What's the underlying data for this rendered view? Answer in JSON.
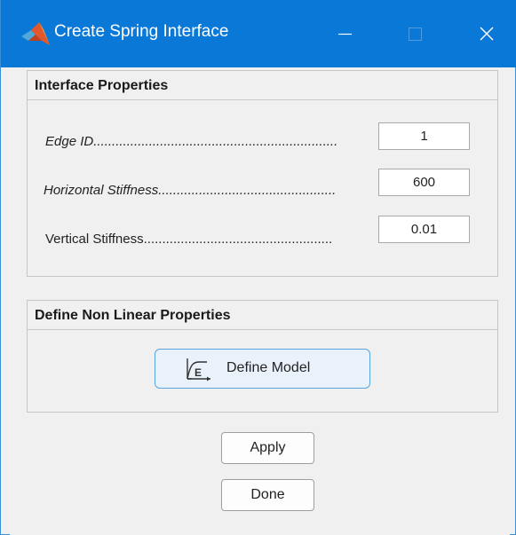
{
  "window": {
    "title": "Create Spring Interface",
    "app_icon": "matlab-logo-icon",
    "title_bar_color": "#0a78d7",
    "controls": [
      "minimize-icon",
      "maximize-icon",
      "close-icon"
    ]
  },
  "interface_properties": {
    "heading": "Interface Properties",
    "fields": [
      {
        "label": "Edge ID",
        "leader": "..................................................................",
        "value": "1"
      },
      {
        "label": "Horizontal Stiffness",
        "leader": "................................................",
        "value": "600"
      },
      {
        "label": "Vertical Stiffness",
        "leader": "...................................................",
        "value": "0.01"
      }
    ]
  },
  "nonlinear": {
    "heading": "Define Non Linear Properties",
    "define_button": {
      "icon": "stress-strain-curve-icon",
      "label": "Define Model"
    }
  },
  "actions": {
    "apply_label": "Apply",
    "done_label": "Done"
  },
  "colors": {
    "accent": "#0a78d7",
    "define_button_border": "#5aa3e0",
    "define_button_bg": "#e9f2fb"
  }
}
